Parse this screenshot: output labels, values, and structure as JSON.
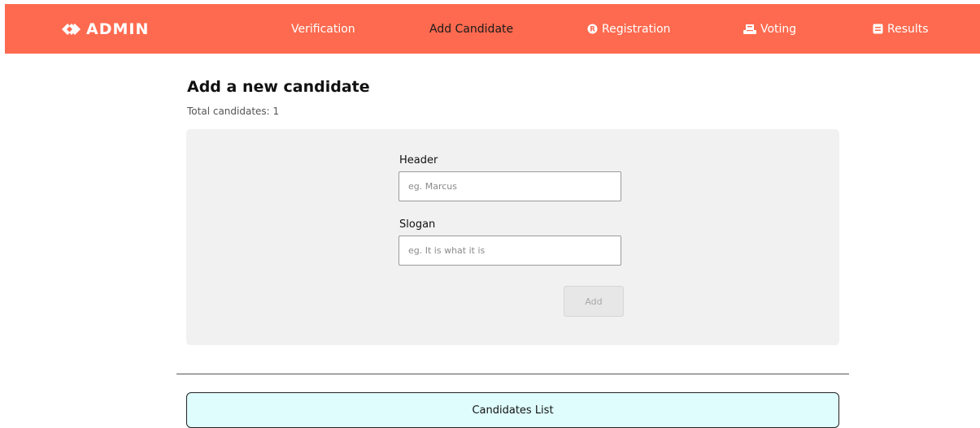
{
  "navbar": {
    "brand": "ADMIN",
    "brand_icon": "double-chevron-icon",
    "background": "#fe6a4f",
    "items": [
      {
        "label": "Verification",
        "icon": null,
        "active": false
      },
      {
        "label": "Add Candidate",
        "icon": null,
        "active": true
      },
      {
        "label": "Registration",
        "icon": "registered-icon",
        "active": false
      },
      {
        "label": "Voting",
        "icon": "ballot-icon",
        "active": false
      },
      {
        "label": "Results",
        "icon": "results-icon",
        "active": false
      }
    ]
  },
  "main": {
    "title": "Add a new candidate",
    "total_candidates": "Total candidates: 1"
  },
  "form": {
    "header_label": "Header",
    "header_placeholder": "eg. Marcus",
    "header_value": "",
    "slogan_label": "Slogan",
    "slogan_placeholder": "eg. It is what it is",
    "slogan_value": "",
    "add_label": "Add"
  },
  "candidates_list": {
    "label": "Candidates List",
    "background": "#dffdfd"
  }
}
